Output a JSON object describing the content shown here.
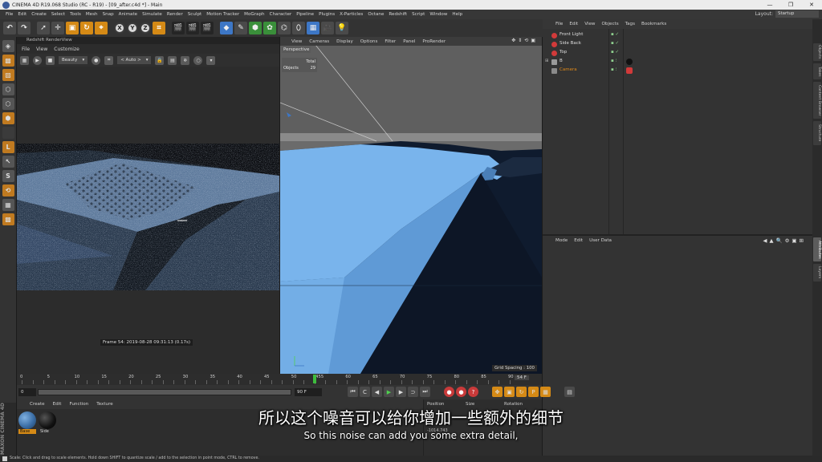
{
  "window": {
    "title": "CINEMA 4D R19.068 Studio (RC - R19) - [09_after.c4d *] - Main",
    "controls": [
      "—",
      "❐",
      "✕"
    ]
  },
  "menubar": {
    "items": [
      "File",
      "Edit",
      "Create",
      "Select",
      "Tools",
      "Mesh",
      "Snap",
      "Animate",
      "Simulate",
      "Render",
      "Sculpt",
      "Motion Tracker",
      "MoGraph",
      "Character",
      "Pipeline",
      "Plugins",
      "X-Particles",
      "Octane",
      "Redshift",
      "Script",
      "Window",
      "Help"
    ],
    "layout_label": "Layout:",
    "layout_value": "Startup"
  },
  "toolbar": {
    "axis_x": "X",
    "axis_y": "Y",
    "axis_z": "Z"
  },
  "renderview": {
    "title": "Redshift RenderView",
    "menu": [
      "File",
      "View",
      "Customize"
    ],
    "aov_select": "Beauty",
    "camera_select": "< Auto >",
    "frame_info": "Frame 54:  2019-08-28  09:31:13  (0.17s)"
  },
  "viewport": {
    "menu": [
      "View",
      "Cameras",
      "Display",
      "Options",
      "Filter",
      "Panel",
      "ProRender"
    ],
    "label": "Perspective",
    "hud_total": "Total",
    "hud_objects_label": "Objects",
    "hud_objects_value": "29",
    "grid_spacing": "Grid Spacing : 100",
    "axis_y": "Y",
    "axis_z": "Z"
  },
  "object_manager": {
    "menu": [
      "File",
      "Edit",
      "View",
      "Objects",
      "Tags",
      "Bookmarks"
    ],
    "objects": [
      {
        "name": "Front Light",
        "icon_color": "#d23a3a",
        "tag_color": ""
      },
      {
        "name": "Side Back",
        "icon_color": "#d23a3a",
        "tag_color": ""
      },
      {
        "name": "Top",
        "icon_color": "#d23a3a",
        "tag_color": ""
      },
      {
        "name": "B",
        "icon_color": "#9a9a9a",
        "tag_color": "#111111"
      },
      {
        "name": "Camera",
        "icon_color": "#8a8a8a",
        "tag_color": "#d23a3a",
        "selected": true
      }
    ]
  },
  "attribute_manager": {
    "menu": [
      "Mode",
      "Edit",
      "User Data"
    ]
  },
  "right_tabs": [
    "Objects",
    "Takes",
    "Content Browser",
    "Structure",
    "Attributes",
    "Layers"
  ],
  "timeline": {
    "ticks": [
      "0",
      "2",
      "4",
      "6",
      "8",
      "10",
      "12",
      "14",
      "16",
      "18",
      "20",
      "22",
      "24",
      "26",
      "28",
      "30",
      "32",
      "34",
      "36",
      "38",
      "40",
      "42",
      "44",
      "46",
      "48",
      "50",
      "52",
      "54",
      "56",
      "58",
      "60",
      "62",
      "64",
      "66",
      "68",
      "70",
      "72",
      "74",
      "76",
      "78",
      "80",
      "82",
      "84",
      "86",
      "88",
      "90"
    ],
    "labels": [
      "0",
      "5",
      "10",
      "15",
      "20",
      "25",
      "30",
      "35",
      "40",
      "45",
      "50",
      "54",
      "55",
      "60",
      "65",
      "70",
      "75",
      "80",
      "85",
      "90"
    ],
    "current_frame": "54",
    "current_frame_display": "54 F"
  },
  "transport": {
    "start": "0 F",
    "min": "0",
    "end": "90 F",
    "max": "90 F"
  },
  "material_manager": {
    "menu": [
      "Create",
      "Edit",
      "Function",
      "Texture"
    ],
    "materials": [
      {
        "name": "Base",
        "color": "#3b6ea6",
        "selected": true
      },
      {
        "name": "Side",
        "color": "#111111",
        "selected": false
      }
    ],
    "brand": "MAXON CINEMA 4D"
  },
  "coordinates": {
    "position": "Position",
    "size": "Size",
    "rotation": "Rotation",
    "x_value": "-1014.743"
  },
  "statusbar": {
    "text": "Scale: Click and drag to scale elements. Hold down SHIFT to quantize scale / add to the selection in point mode, CTRL to remove."
  },
  "subtitles": {
    "cn": "所以这个噪音可以给你增加一些额外的细节",
    "en": "So this noise can add you some extra detail,"
  },
  "colors": {
    "accent": "#d58a16",
    "viewport_blue": "#79b4ec",
    "selected_object": "#e08a1a"
  }
}
